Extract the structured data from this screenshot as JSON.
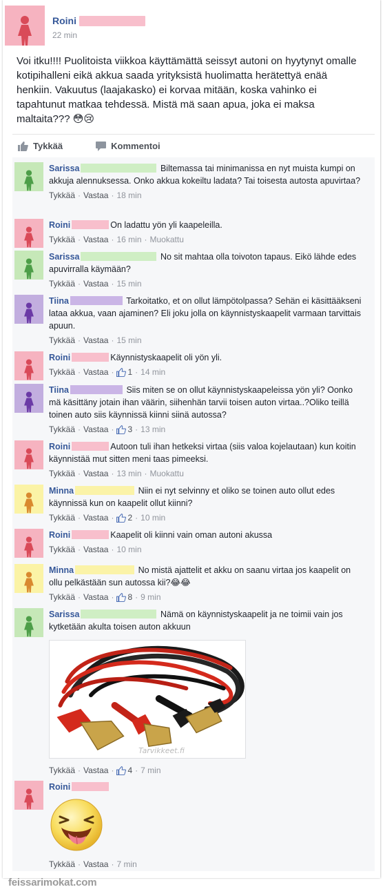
{
  "post": {
    "author": "Roini",
    "time": "22 min",
    "text": "Voi itku!!!! Puolitoista viikkoa käyttämättä seissyt autoni on hyytynyt omalle kotipihalleni eikä akkua saada yrityksistä huolimatta herätettyä enää henkiin. Vakuutus (laajakasko) ei korvaa mitään, koska vahinko ei tapahtunut matkaa tehdessä. Mistä mä saan apua, joka ei maksa maltaita??? 😳😢",
    "like_label": "Tykkää",
    "comment_label": "Kommentoi"
  },
  "labels": {
    "like": "Tykkää",
    "reply": "Vastaa",
    "edited": "Muokattu",
    "sep": "·"
  },
  "colors": {
    "pink": "#f6b3c0",
    "green": "#c6e8b8",
    "purple": "#c2aedf",
    "yellow": "#fbf3a6",
    "link": "#365899"
  },
  "comments": [
    {
      "name": "Sarissa",
      "text": "Biltemassa tai minimanissa en nyt muista kumpi on akkuja alennuksessa. Onko akkua kokeiltu ladata? Tai toisesta autosta apuvirtaa?",
      "time": "18 min"
    },
    {
      "name": "Roini",
      "text": "On ladattu yön yli kaapeleilla.",
      "time": "16 min"
    },
    {
      "name": "Sarissa",
      "text": "No sit mahtaa olla toivoton tapaus. Eikö lähde edes apuvirralla käymään?",
      "time": "15 min"
    },
    {
      "name": "Tiina",
      "text": "Tarkoitatko, et on ollut lämpötolpassa? Sehän ei käsittääkseni lataa akkua, vaan ajaminen? Eli joku jolla on käynnistyskaapelit varmaan tarvittais apuun.",
      "time": "15 min"
    },
    {
      "name": "Roini",
      "text": "Käynnistyskaapelit oli yön yli.",
      "likes": "1",
      "time": "14 min"
    },
    {
      "name": "Tiina",
      "text": "Siis miten se on ollut käynnistyskaapeleissa yön yli? Oonko mä käsittäny jotain ihan väärin, siihenhän tarvii toisen auton virtaa..?Oliko teillä toinen auto siis käynnissä kiinni siinä autossa?",
      "likes": "3",
      "time": "13 min"
    },
    {
      "name": "Roini",
      "text": "Autoon tuli ihan hetkeksi virtaa (siis valoa kojelautaan) kun koitin käynnistää mut sitten meni taas pimeeksi.",
      "time": "13 min"
    },
    {
      "name": "Minna",
      "text": "Niin ei nyt selvinny et oliko se toinen auto ollut edes käynnissä kun on kaapelit ollut kiinni?",
      "likes": "2",
      "time": "10 min"
    },
    {
      "name": "Roini",
      "text": "Kaapelit oli kiinni vain oman autoni akussa",
      "time": "10 min"
    },
    {
      "name": "Minna",
      "text": "No mistä ajattelit et akku on saanu virtaa jos kaapelit on ollu pelkästään sun autossa kii?😂😂",
      "likes": "8",
      "time": "9 min"
    },
    {
      "name": "Sarissa",
      "text": "Nämä on käynnistyskaapelit ja ne toimii vain jos kytketään akulta toisen auton akkuun",
      "likes": "4",
      "time": "7 min",
      "image_watermark": "Tarvikkeet.fi"
    },
    {
      "name": "Roini",
      "time": "7 min"
    }
  ],
  "watermark": "feissarimokat.com",
  "icons": [
    "person-icon",
    "thumbs-up-icon",
    "comment-icon",
    "like-count-icon",
    "laughing-sticker"
  ]
}
